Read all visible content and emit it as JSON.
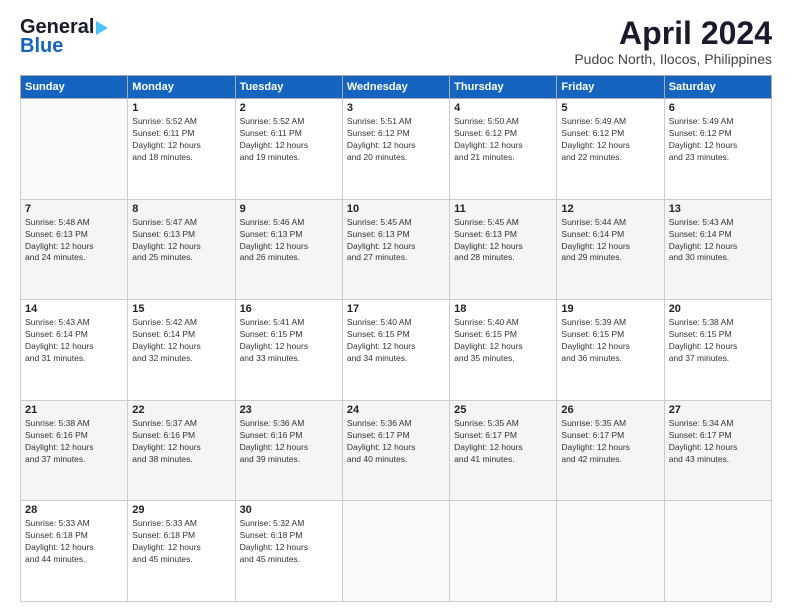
{
  "logo": {
    "line1": "General",
    "line2": "Blue"
  },
  "title": "April 2024",
  "location": "Pudoc North, Ilocos, Philippines",
  "days_of_week": [
    "Sunday",
    "Monday",
    "Tuesday",
    "Wednesday",
    "Thursday",
    "Friday",
    "Saturday"
  ],
  "weeks": [
    [
      {
        "day": "",
        "info": ""
      },
      {
        "day": "1",
        "info": "Sunrise: 5:52 AM\nSunset: 6:11 PM\nDaylight: 12 hours\nand 18 minutes."
      },
      {
        "day": "2",
        "info": "Sunrise: 5:52 AM\nSunset: 6:11 PM\nDaylight: 12 hours\nand 19 minutes."
      },
      {
        "day": "3",
        "info": "Sunrise: 5:51 AM\nSunset: 6:12 PM\nDaylight: 12 hours\nand 20 minutes."
      },
      {
        "day": "4",
        "info": "Sunrise: 5:50 AM\nSunset: 6:12 PM\nDaylight: 12 hours\nand 21 minutes."
      },
      {
        "day": "5",
        "info": "Sunrise: 5:49 AM\nSunset: 6:12 PM\nDaylight: 12 hours\nand 22 minutes."
      },
      {
        "day": "6",
        "info": "Sunrise: 5:49 AM\nSunset: 6:12 PM\nDaylight: 12 hours\nand 23 minutes."
      }
    ],
    [
      {
        "day": "7",
        "info": "Sunrise: 5:48 AM\nSunset: 6:13 PM\nDaylight: 12 hours\nand 24 minutes."
      },
      {
        "day": "8",
        "info": "Sunrise: 5:47 AM\nSunset: 6:13 PM\nDaylight: 12 hours\nand 25 minutes."
      },
      {
        "day": "9",
        "info": "Sunrise: 5:46 AM\nSunset: 6:13 PM\nDaylight: 12 hours\nand 26 minutes."
      },
      {
        "day": "10",
        "info": "Sunrise: 5:45 AM\nSunset: 6:13 PM\nDaylight: 12 hours\nand 27 minutes."
      },
      {
        "day": "11",
        "info": "Sunrise: 5:45 AM\nSunset: 6:13 PM\nDaylight: 12 hours\nand 28 minutes."
      },
      {
        "day": "12",
        "info": "Sunrise: 5:44 AM\nSunset: 6:14 PM\nDaylight: 12 hours\nand 29 minutes."
      },
      {
        "day": "13",
        "info": "Sunrise: 5:43 AM\nSunset: 6:14 PM\nDaylight: 12 hours\nand 30 minutes."
      }
    ],
    [
      {
        "day": "14",
        "info": "Sunrise: 5:43 AM\nSunset: 6:14 PM\nDaylight: 12 hours\nand 31 minutes."
      },
      {
        "day": "15",
        "info": "Sunrise: 5:42 AM\nSunset: 6:14 PM\nDaylight: 12 hours\nand 32 minutes."
      },
      {
        "day": "16",
        "info": "Sunrise: 5:41 AM\nSunset: 6:15 PM\nDaylight: 12 hours\nand 33 minutes."
      },
      {
        "day": "17",
        "info": "Sunrise: 5:40 AM\nSunset: 6:15 PM\nDaylight: 12 hours\nand 34 minutes."
      },
      {
        "day": "18",
        "info": "Sunrise: 5:40 AM\nSunset: 6:15 PM\nDaylight: 12 hours\nand 35 minutes."
      },
      {
        "day": "19",
        "info": "Sunrise: 5:39 AM\nSunset: 6:15 PM\nDaylight: 12 hours\nand 36 minutes."
      },
      {
        "day": "20",
        "info": "Sunrise: 5:38 AM\nSunset: 6:15 PM\nDaylight: 12 hours\nand 37 minutes."
      }
    ],
    [
      {
        "day": "21",
        "info": "Sunrise: 5:38 AM\nSunset: 6:16 PM\nDaylight: 12 hours\nand 37 minutes."
      },
      {
        "day": "22",
        "info": "Sunrise: 5:37 AM\nSunset: 6:16 PM\nDaylight: 12 hours\nand 38 minutes."
      },
      {
        "day": "23",
        "info": "Sunrise: 5:36 AM\nSunset: 6:16 PM\nDaylight: 12 hours\nand 39 minutes."
      },
      {
        "day": "24",
        "info": "Sunrise: 5:36 AM\nSunset: 6:17 PM\nDaylight: 12 hours\nand 40 minutes."
      },
      {
        "day": "25",
        "info": "Sunrise: 5:35 AM\nSunset: 6:17 PM\nDaylight: 12 hours\nand 41 minutes."
      },
      {
        "day": "26",
        "info": "Sunrise: 5:35 AM\nSunset: 6:17 PM\nDaylight: 12 hours\nand 42 minutes."
      },
      {
        "day": "27",
        "info": "Sunrise: 5:34 AM\nSunset: 6:17 PM\nDaylight: 12 hours\nand 43 minutes."
      }
    ],
    [
      {
        "day": "28",
        "info": "Sunrise: 5:33 AM\nSunset: 6:18 PM\nDaylight: 12 hours\nand 44 minutes."
      },
      {
        "day": "29",
        "info": "Sunrise: 5:33 AM\nSunset: 6:18 PM\nDaylight: 12 hours\nand 45 minutes."
      },
      {
        "day": "30",
        "info": "Sunrise: 5:32 AM\nSunset: 6:18 PM\nDaylight: 12 hours\nand 45 minutes."
      },
      {
        "day": "",
        "info": ""
      },
      {
        "day": "",
        "info": ""
      },
      {
        "day": "",
        "info": ""
      },
      {
        "day": "",
        "info": ""
      }
    ]
  ]
}
